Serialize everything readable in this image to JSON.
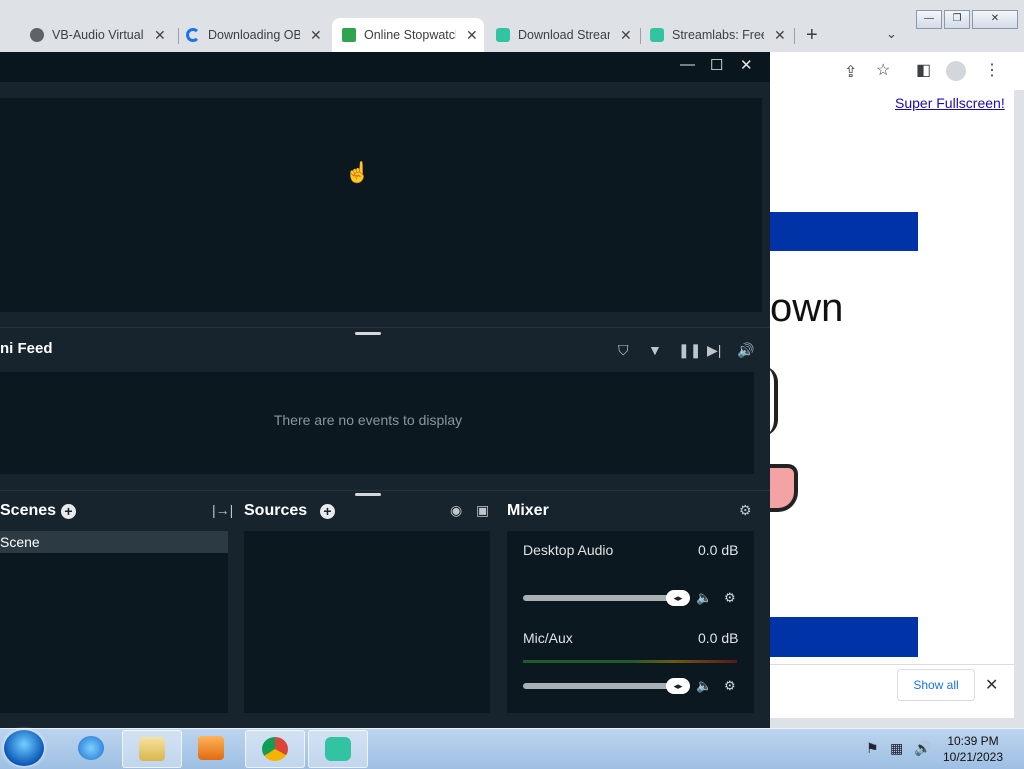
{
  "chrome": {
    "tabs": [
      {
        "title": "VB-Audio Virtual",
        "icon": "globe-icon",
        "color": "#5f6368"
      },
      {
        "title": "Downloading OBS",
        "icon": "obs-loading-icon",
        "color": "#1a73e8"
      },
      {
        "title": "Online Stopwatch",
        "icon": "stopwatch-icon",
        "color": "#2ea44f",
        "active": true
      },
      {
        "title": "Download Stream",
        "icon": "streamlabs-icon",
        "color": "#31c3a2"
      },
      {
        "title": "Streamlabs: Free",
        "icon": "streamlabs-icon",
        "color": "#31c3a2"
      }
    ],
    "tab_close": "✕",
    "new_tab": "+",
    "tab_menu": "⌄",
    "window_buttons": {
      "minimize": "—",
      "restore": "❐",
      "close": "✕"
    },
    "page": {
      "fullscreen_link": "Super Fullscreen!",
      "big_text_fragment": "own",
      "accent_blue": "#0033a8"
    },
    "download_bar": {
      "show_all": "Show all",
      "close": "✕"
    }
  },
  "streamlabs": {
    "window_buttons": {
      "minimize": "—",
      "maximize": "☐",
      "close": "✕"
    },
    "feed": {
      "title": "ni Feed",
      "empty_message": "There are no events to display"
    },
    "scenes": {
      "title": "Scenes",
      "items": [
        "Scene"
      ]
    },
    "sources": {
      "title": "Sources"
    },
    "mixer": {
      "title": "Mixer",
      "channels": [
        {
          "name": "Desktop Audio",
          "db": "0.0 dB",
          "level": 1.0
        },
        {
          "name": "Mic/Aux",
          "db": "0.0 dB",
          "level": 1.0
        }
      ]
    }
  },
  "taskbar": {
    "clock_time": "10:39 PM",
    "clock_date": "10/21/2023",
    "apps": [
      "internet-explorer",
      "file-explorer",
      "media-player",
      "chrome",
      "streamlabs"
    ]
  }
}
